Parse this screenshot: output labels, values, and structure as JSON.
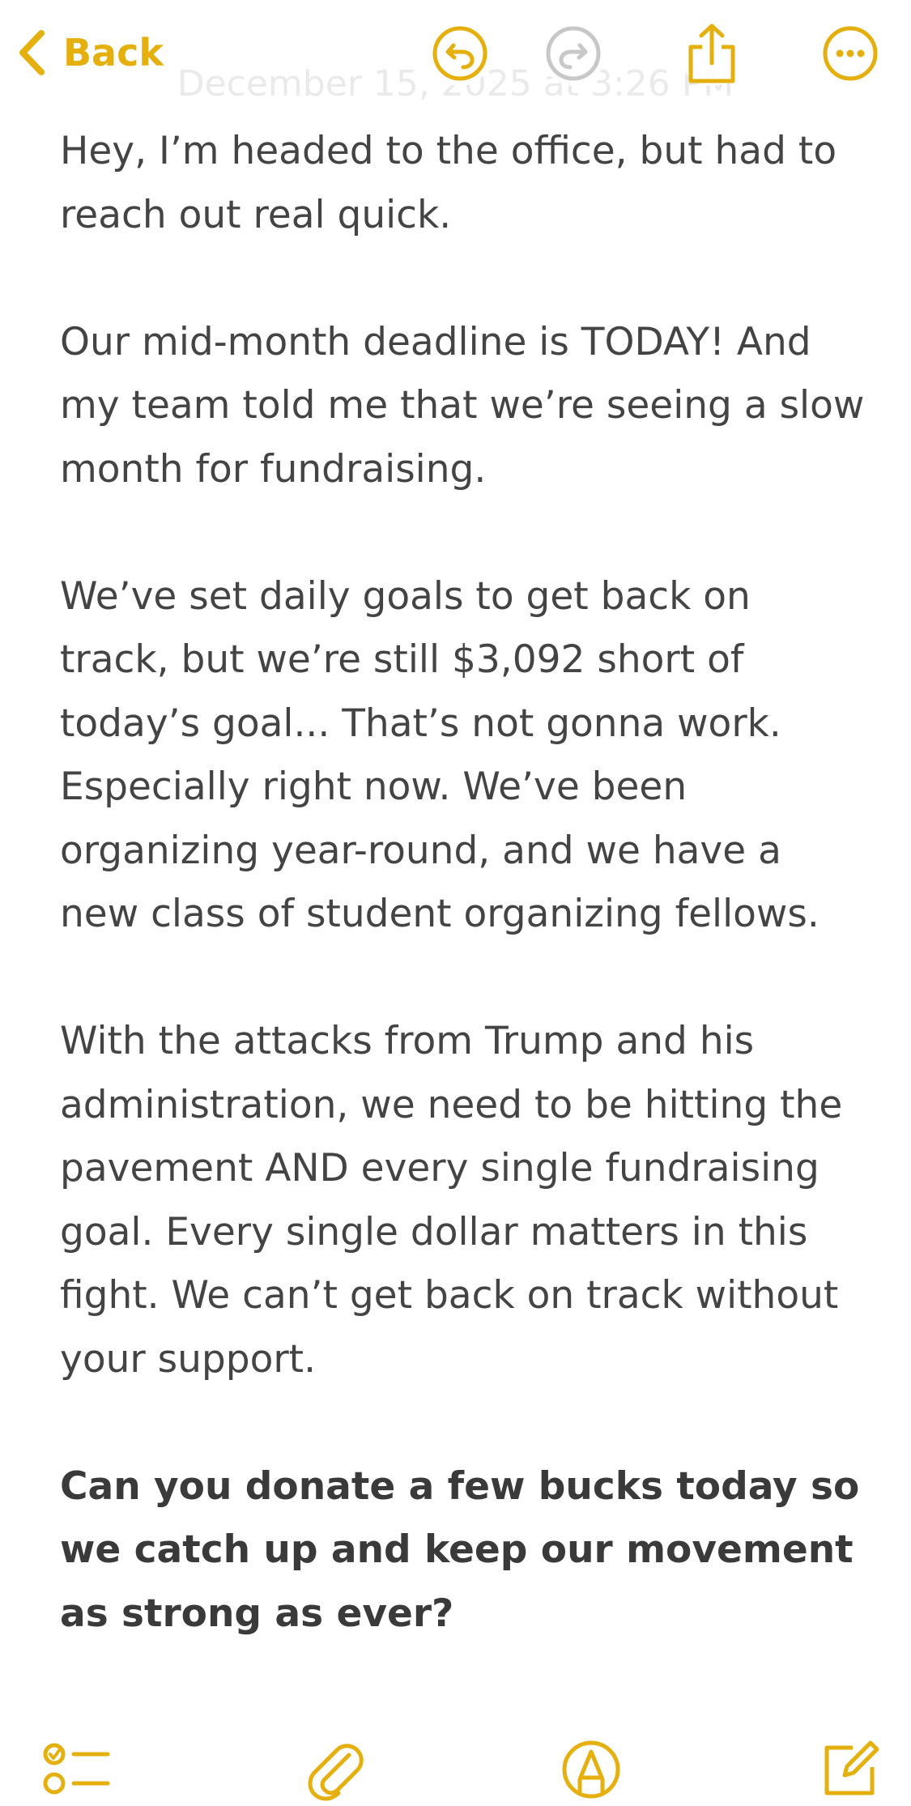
{
  "app": {
    "accent_color": "#E5B00E",
    "disabled_color": "#C8C8C8",
    "text_color": "#444444"
  },
  "toolbar": {
    "back_label": "Back",
    "faded_date": "December 15, 2025 at 3:26 PM",
    "icons": [
      "undo-icon",
      "redo-icon",
      "share-icon",
      "more-icon"
    ]
  },
  "note": {
    "paragraphs": [
      "Hey, I’m headed to the office, but had to reach out real quick.",
      "Our mid-month deadline is TODAY! And my team told me that we’re seeing a slow month for fundraising.",
      "We’ve set daily goals to get back on track, but we’re still $3,092 short of today’s goal... That’s not gonna work. Especially right now. We’ve been organizing year-round, and we have a new class of student organizing fellows.",
      "With the attacks from Trump and his administration, we need to be hitting the pavement AND every single fundraising goal. Every single dollar matters in this fight. We can’t get back on track without your support."
    ],
    "closing_bold": "Can you donate a few bucks today so we catch up and keep our movement as strong as ever?"
  },
  "bottom_toolbar": {
    "icons": [
      "checklist-icon",
      "attachment-icon",
      "markup-icon",
      "compose-icon"
    ]
  }
}
